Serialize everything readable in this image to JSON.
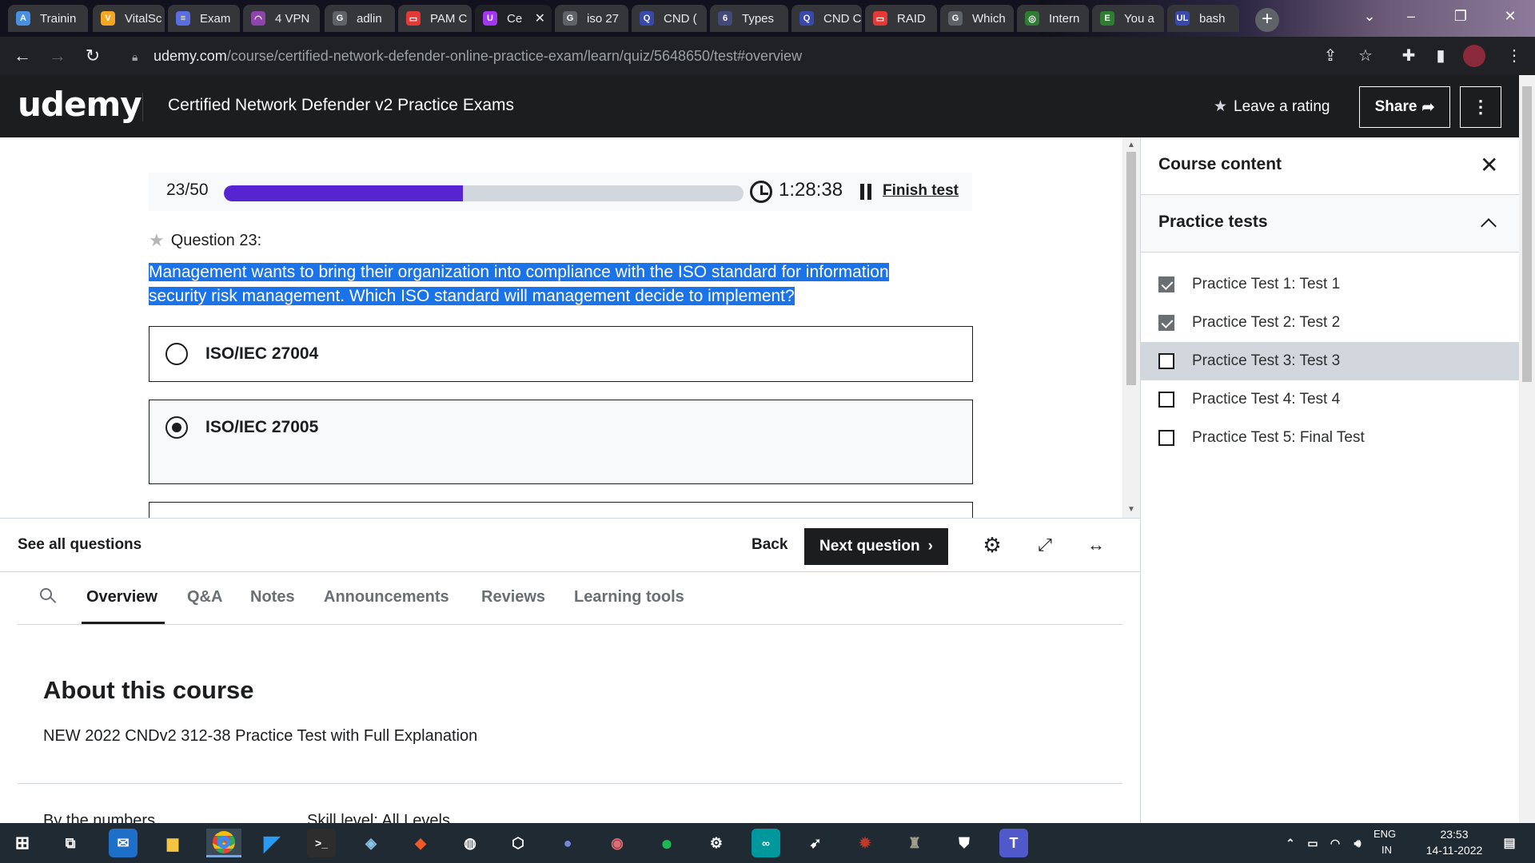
{
  "browser": {
    "tabs": [
      {
        "label": "Trainin",
        "fav": "A",
        "color": "#4a90e2"
      },
      {
        "label": "VitalSc",
        "fav": "V",
        "color": "#f5a623"
      },
      {
        "label": "Exam",
        "fav": "≡",
        "color": "#5b6ee1"
      },
      {
        "label": "4 VPN",
        "fav": "◠",
        "color": "#8e44ad"
      },
      {
        "label": "adlin",
        "fav": "G",
        "color": "#5f6368"
      },
      {
        "label": "PAM C",
        "fav": "▭",
        "color": "#e53935"
      },
      {
        "label": "Ce",
        "fav": "U",
        "color": "#a435f0",
        "active": true
      },
      {
        "label": "iso 27",
        "fav": "G",
        "color": "#5f6368"
      },
      {
        "label": "CND (",
        "fav": "Q",
        "color": "#3949ab"
      },
      {
        "label": "Types",
        "fav": "6",
        "color": "#424a7a"
      },
      {
        "label": "CND C",
        "fav": "Q",
        "color": "#3949ab"
      },
      {
        "label": "RAID",
        "fav": "▭",
        "color": "#e53935"
      },
      {
        "label": "Which",
        "fav": "G",
        "color": "#5f6368"
      },
      {
        "label": "Intern",
        "fav": "◎",
        "color": "#2e7d32"
      },
      {
        "label": "You a",
        "fav": "E",
        "color": "#2e7d32"
      },
      {
        "label": "bash",
        "fav": "UL",
        "color": "#3949ab"
      }
    ],
    "url_host": "udemy.com",
    "url_path": "/course/certified-network-defender-online-practice-exam/learn/quiz/5648650/test#overview"
  },
  "header": {
    "logo": "udemy",
    "course_title": "Certified Network Defender v2 Practice Exams",
    "rating_label": "Leave a rating",
    "share_label": "Share"
  },
  "quiz": {
    "counter": "23/50",
    "progress": 0.46,
    "timer": "1:28:38",
    "finish_label": "Finish test",
    "question_label": "Question 23:",
    "question_text": "Management wants to bring their organization into compliance with the ISO standard for information security risk management. Which ISO standard will management decide to implement?",
    "options": [
      {
        "label": "ISO/IEC 27004",
        "selected": false
      },
      {
        "label": "ISO/IEC 27005",
        "selected": true
      }
    ]
  },
  "controls": {
    "see_all": "See all questions",
    "back": "Back",
    "next": "Next question"
  },
  "course_tabs": [
    "Overview",
    "Q&A",
    "Notes",
    "Announcements",
    "Reviews",
    "Learning tools"
  ],
  "about": {
    "title": "About this course",
    "description": "NEW 2022 CNDv2 312-38 Practice Test with Full Explanation",
    "by_numbers": "By the numbers",
    "skill_level": "Skill level: All Levels"
  },
  "sidebar": {
    "title": "Course content",
    "section": "Practice tests",
    "items": [
      {
        "label": "Practice Test 1: Test 1",
        "checked": true,
        "current": false
      },
      {
        "label": "Practice Test 2: Test 2",
        "checked": true,
        "current": false
      },
      {
        "label": "Practice Test 3: Test 3",
        "checked": false,
        "current": true
      },
      {
        "label": "Practice Test 4: Test 4",
        "checked": false,
        "current": false
      },
      {
        "label": "Practice Test 5: Final Test",
        "checked": false,
        "current": false
      }
    ]
  },
  "taskbar": {
    "lang1": "ENG",
    "lang2": "IN",
    "time": "23:53",
    "date": "14-11-2022",
    "notification_count": "1"
  },
  "colors": {
    "accent": "#5624d0",
    "brand": "#a435f0",
    "selection": "#1a73e8"
  }
}
